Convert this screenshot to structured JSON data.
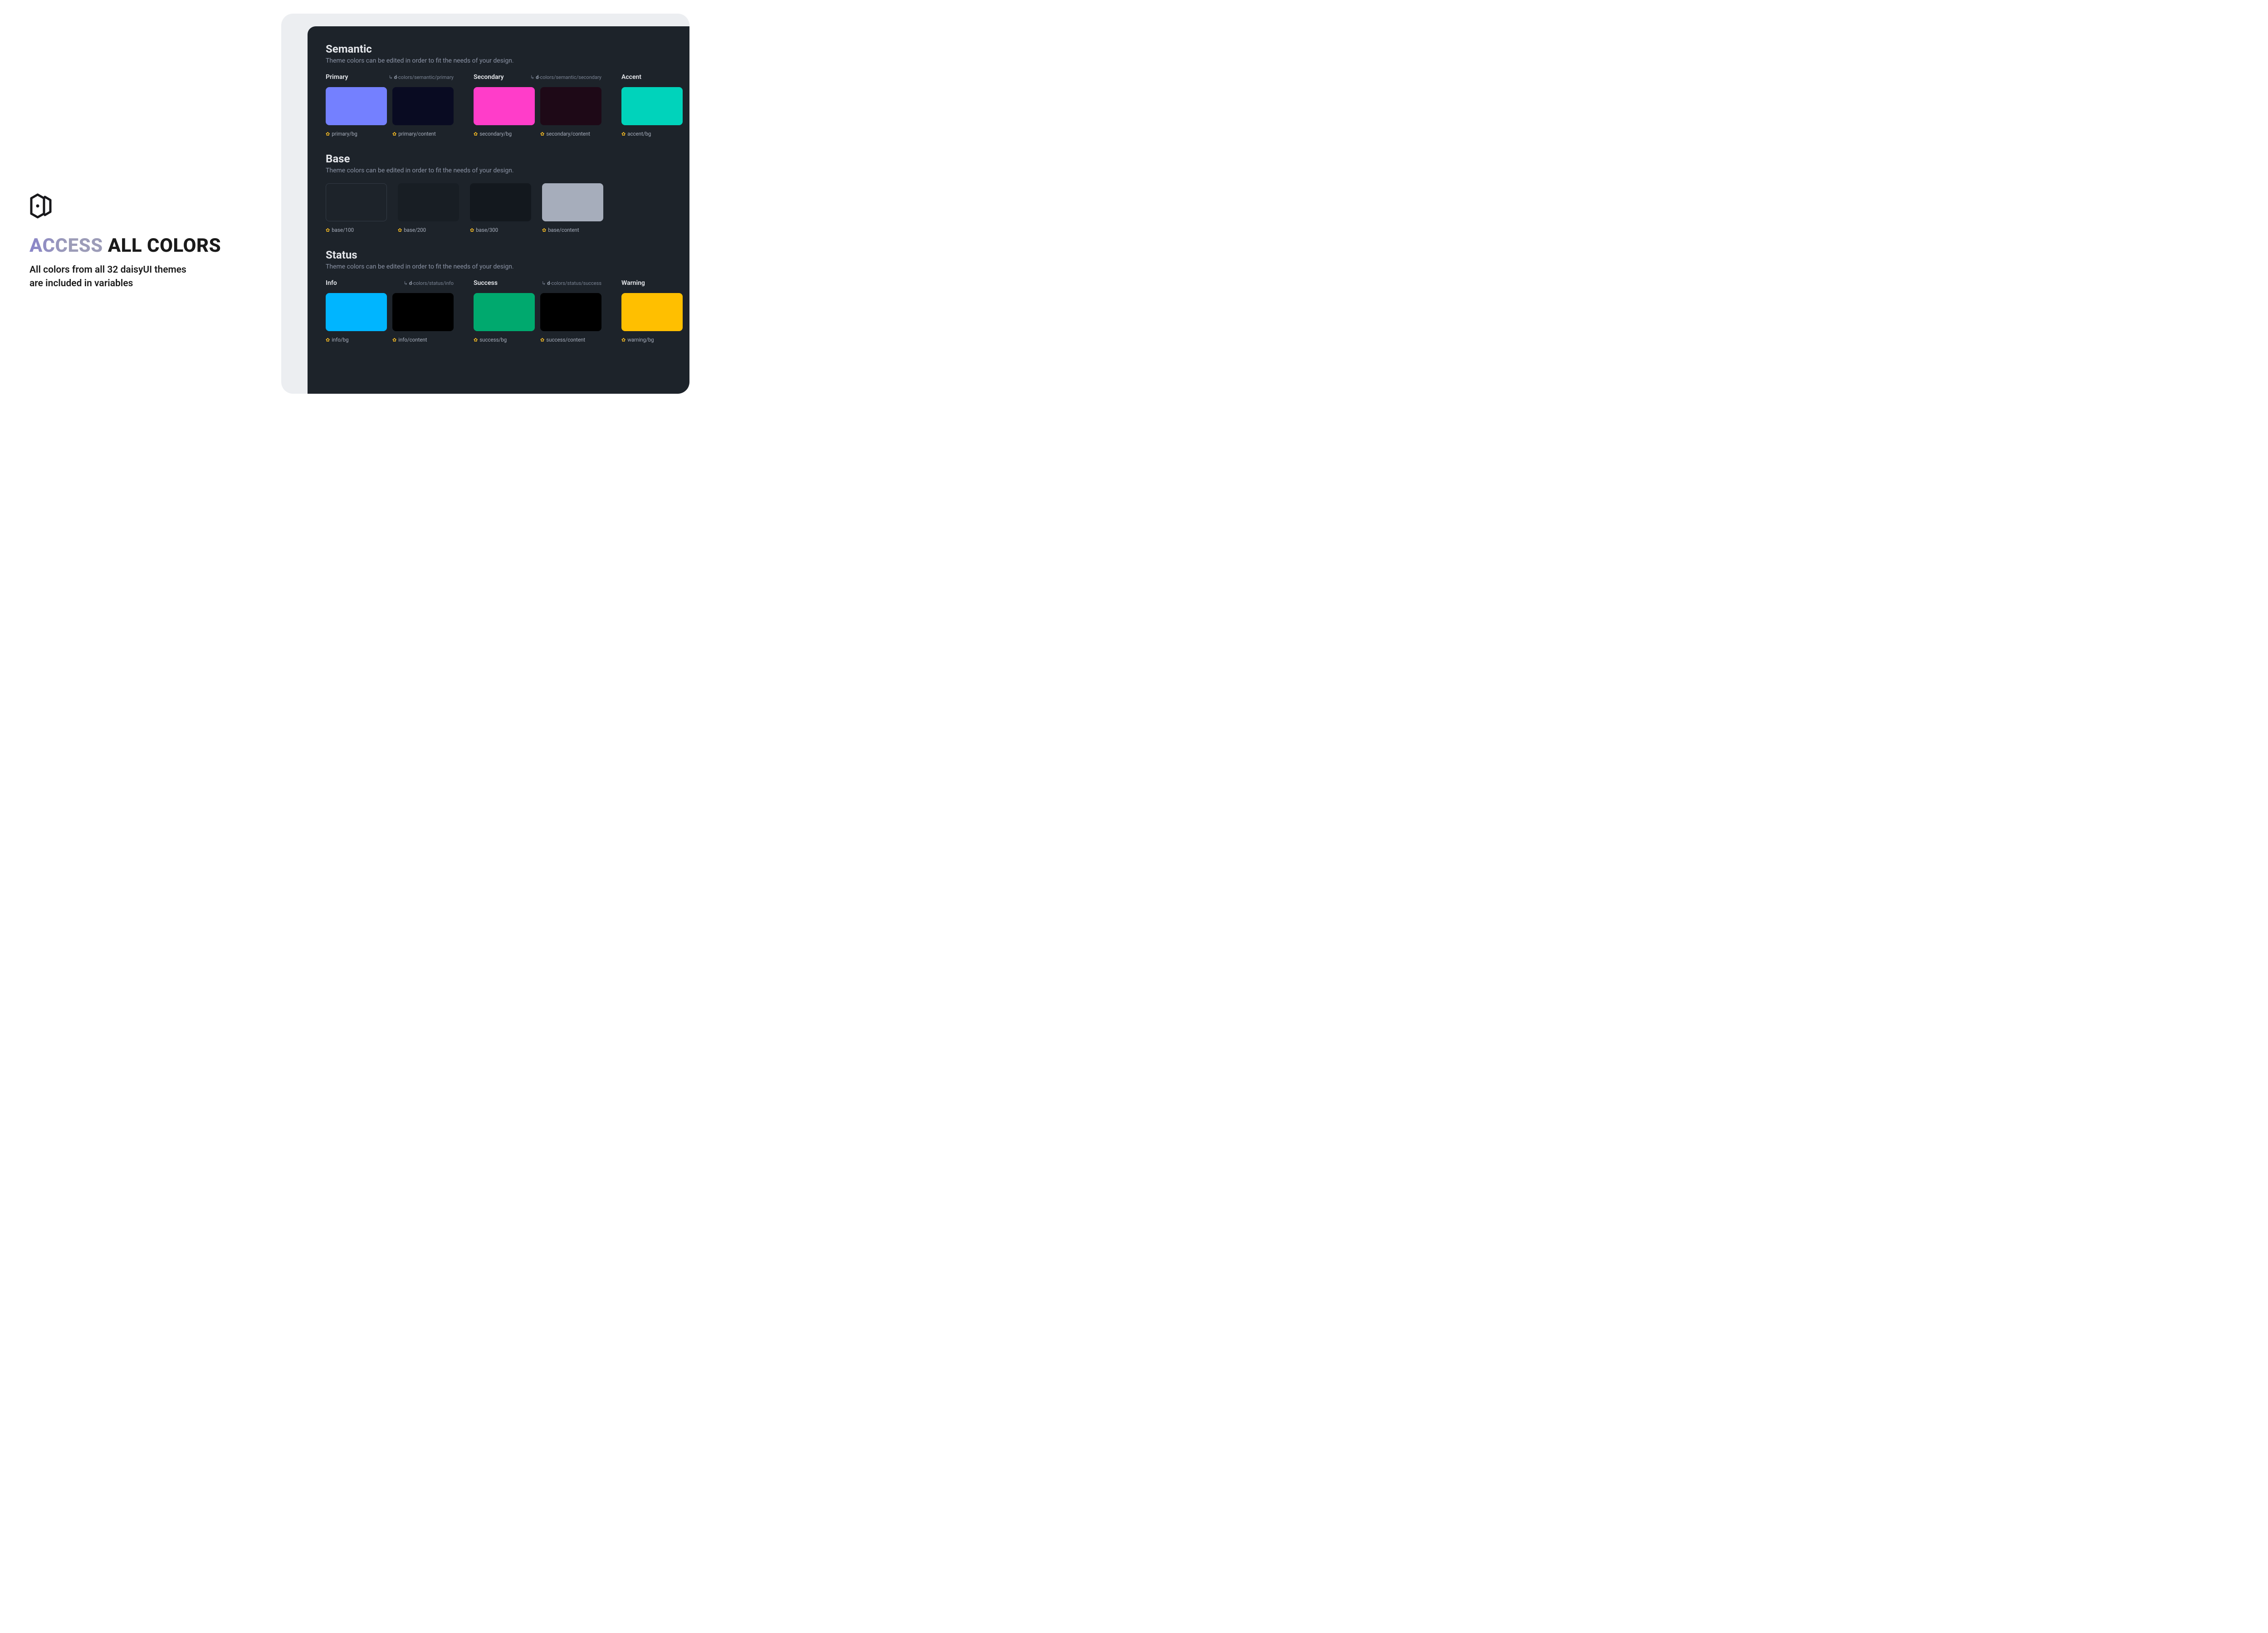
{
  "left": {
    "headline_access": "ACCESS ",
    "headline_all": "ALL COLORS",
    "subline1": "All colors from all 32 daisyUI themes",
    "subline2": "are included in variables"
  },
  "panel": {
    "semantic": {
      "title": "Semantic",
      "desc": "Theme colors can be edited in order to fit the needs of your design.",
      "primary": {
        "name": "Primary",
        "path_prefix": "↳",
        "path_b": "d",
        "path_rest": "-colors/semantic/primary",
        "bg_label": "primary/bg",
        "content_label": "primary/content",
        "bg_color": "#7480ff",
        "content_color": "#090b22"
      },
      "secondary": {
        "name": "Secondary",
        "path_prefix": "↳",
        "path_b": "d",
        "path_rest": "-colors/semantic/secondary",
        "bg_label": "secondary/bg",
        "content_label": "secondary/content",
        "bg_color": "#ff3dc9",
        "content_color": "#1e0917"
      },
      "accent": {
        "name": "Accent",
        "bg_label": "accent/bg",
        "bg_color": "#00d3bb"
      }
    },
    "base": {
      "title": "Base",
      "desc": "Theme colors can be edited in order to fit the needs of your design.",
      "items": [
        {
          "label": "base/100",
          "color": "#1d232a",
          "bordered": true
        },
        {
          "label": "base/200",
          "color": "#181e24",
          "bordered": false
        },
        {
          "label": "base/300",
          "color": "#13181e",
          "bordered": false
        },
        {
          "label": "base/content",
          "color": "#a6adbb",
          "bordered": false
        }
      ]
    },
    "status": {
      "title": "Status",
      "desc": "Theme colors can be edited in order to fit the needs of your design.",
      "info": {
        "name": "Info",
        "path_prefix": "↳",
        "path_b": "d",
        "path_rest": "-colors/status/info",
        "bg_label": "info/bg",
        "content_label": "info/content",
        "bg_color": "#00b5ff",
        "content_color": "#000000"
      },
      "success": {
        "name": "Success",
        "path_prefix": "↳",
        "path_b": "d",
        "path_rest": "-colors/status/success",
        "bg_label": "success/bg",
        "content_label": "success/content",
        "bg_color": "#00a96e",
        "content_color": "#000000"
      },
      "warning": {
        "name": "Warning",
        "bg_label": "warning/bg",
        "bg_color": "#ffbf00"
      }
    }
  }
}
